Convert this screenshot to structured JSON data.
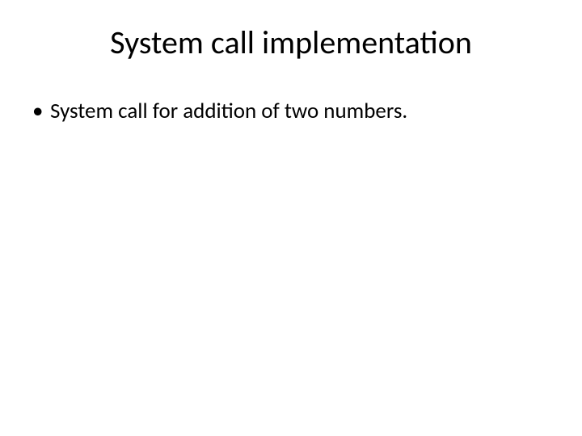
{
  "slide": {
    "title": "System call implementation",
    "bullets": [
      "System call for addition of two numbers."
    ]
  }
}
